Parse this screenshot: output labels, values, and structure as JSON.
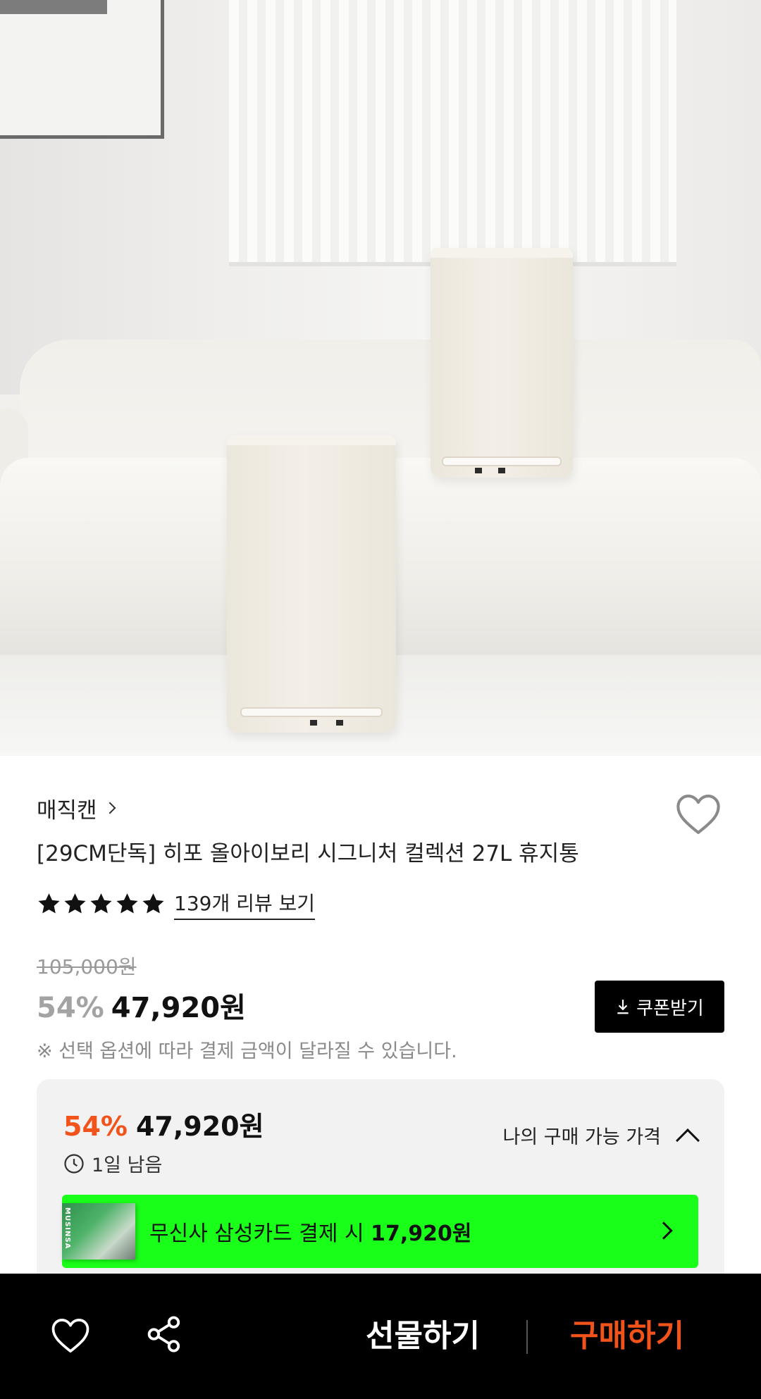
{
  "product": {
    "brand": "매직캔",
    "title": "[29CM단독] 히포 올아이보리 시그니처 컬렉션 27L 휴지통",
    "rating_stars": 5,
    "review_link": "139개 리뷰 보기",
    "original_price": "105,000원",
    "discount": "54%",
    "sale_price": "47,920원",
    "notice": "※ 선택 옵션에 따라 결제 금액이 달라질 수 있습니다."
  },
  "coupon": {
    "label": "쿠폰받기"
  },
  "price_card": {
    "discount": "54%",
    "sale_price": "47,920원",
    "time_left": "1일 남음",
    "my_price_label": "나의 구매 가능 가격",
    "banner": {
      "thumb_text": "MUSINSA",
      "text_prefix": "무신사 삼성카드 결제 시 ",
      "text_amount": "17,920원"
    }
  },
  "bottom_bar": {
    "gift_label": "선물하기",
    "buy_label": "구매하기"
  },
  "colors": {
    "accent": "#f2531b",
    "banner_green": "#19ff19",
    "bar_background": "#000000"
  }
}
